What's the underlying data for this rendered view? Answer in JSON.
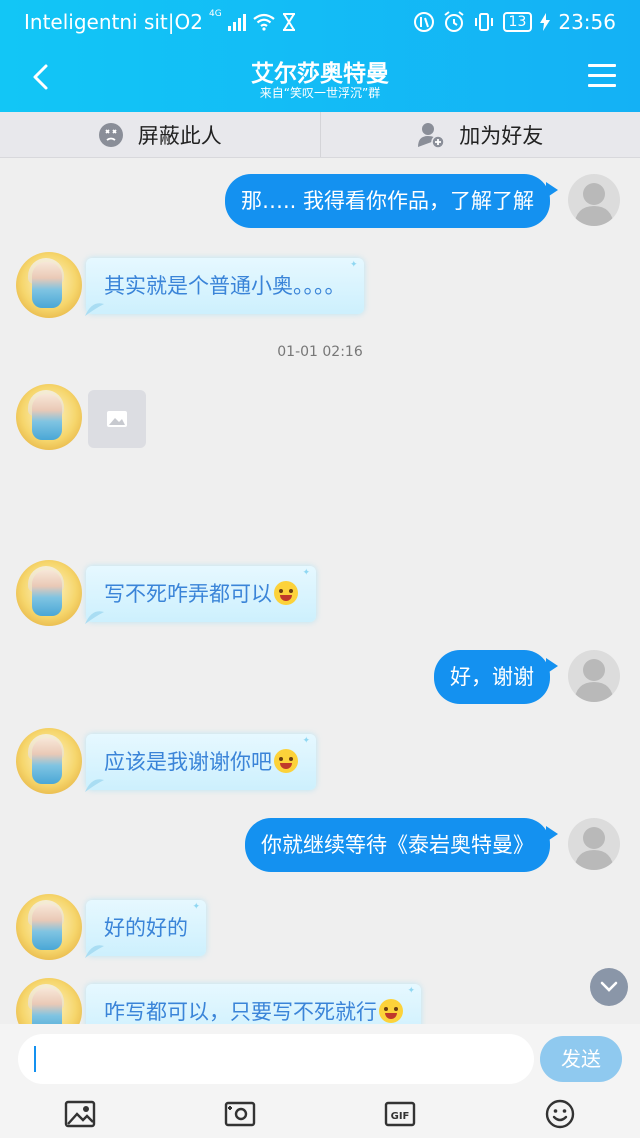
{
  "status_bar": {
    "carrier": "Inteligentni sit|O2",
    "network": "4G",
    "battery": "13",
    "time": "23:56"
  },
  "nav": {
    "title": "艾尔莎奥特曼",
    "subtitle": "来自“笑叹一世浮沉”群"
  },
  "actions": {
    "block_label": "屏蔽此人",
    "add_friend_label": "加为好友"
  },
  "messages": [
    {
      "side": "right",
      "text": "那….. 我得看你作品，了解了解"
    },
    {
      "side": "left",
      "text": "其实就是个普通小奥。。。。"
    },
    {
      "side": "left",
      "type": "image"
    },
    {
      "side": "left",
      "text": "写不死咋弄都可以",
      "emoji": "laughing"
    },
    {
      "side": "right",
      "text": "好，谢谢"
    },
    {
      "side": "left",
      "text": "应该是我谢谢你吧",
      "emoji": "flushed"
    },
    {
      "side": "right",
      "text": "你就继续等待《泰岩奥特曼》"
    },
    {
      "side": "left",
      "text": "好的好的"
    },
    {
      "side": "left",
      "text": "咋写都可以，只要写不死就行",
      "emoji": "smirk"
    }
  ],
  "timestamp": "01-01 02:16",
  "input": {
    "value": "",
    "placeholder": "",
    "send_label": "发送"
  },
  "toolbar": [
    "image-icon",
    "camera-icon",
    "gif-icon",
    "emoji-icon"
  ],
  "colors": {
    "header": "#14b8f5",
    "bubble_right": "#1491f0",
    "bubble_left_bg": "#d9f4fe",
    "bubble_left_text": "#3a84d8",
    "send_button": "#8fc9ef"
  }
}
